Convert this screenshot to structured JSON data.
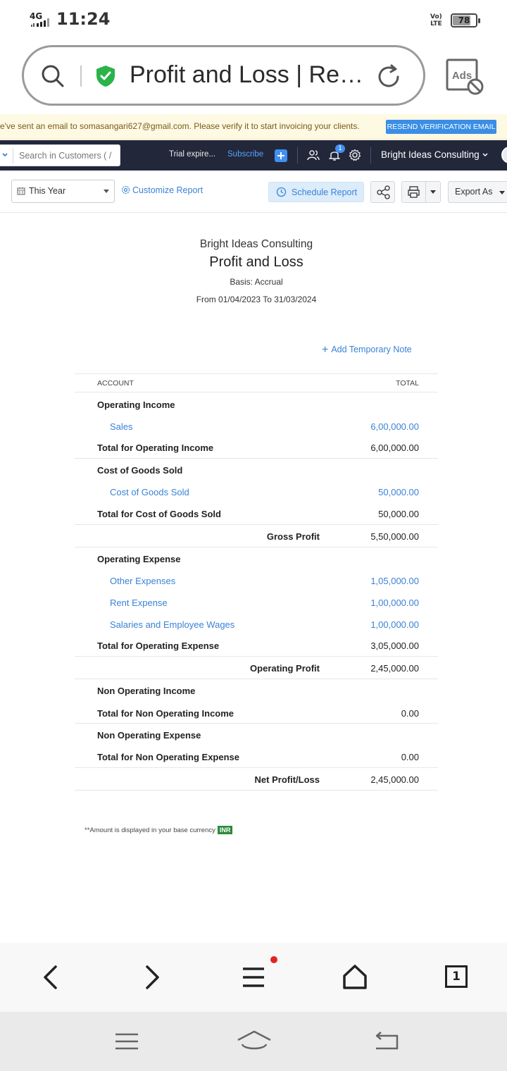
{
  "status_bar": {
    "network": "4G",
    "time": "11:24",
    "volte": "Vo) LTE",
    "battery_level": 78,
    "battery_text": "78"
  },
  "browser": {
    "tab_title": "Profit and Loss | Rep...",
    "ads_label": "Ads"
  },
  "banner": {
    "message": "e've sent an email to somasangari627@gmail.com. Please verify it to start invoicing your clients.",
    "button": "RESEND VERIFICATION EMAIL"
  },
  "app_bar": {
    "search_placeholder": "Search in Customers ( /",
    "trial_text": "Trial expire...",
    "subscribe": "Subscribe",
    "notification_count": "1",
    "org_name": "Bright Ideas Consulting"
  },
  "toolbar": {
    "period": "This Year",
    "customize": "Customize Report",
    "schedule": "Schedule Report",
    "export": "Export As"
  },
  "report": {
    "company": "Bright Ideas Consulting",
    "title": "Profit and Loss",
    "basis": "Basis: Accrual",
    "range": "From 01/04/2023 To 31/03/2024",
    "add_note": "Add Temporary Note",
    "col_account": "ACCOUNT",
    "col_total": "TOTAL",
    "rows": [
      {
        "label": "Operating Income",
        "amount": ""
      },
      {
        "label": "Sales",
        "amount": "6,00,000.00"
      },
      {
        "label": "Total for Operating Income",
        "amount": "6,00,000.00"
      },
      {
        "label": "Cost of Goods Sold",
        "amount": ""
      },
      {
        "label": "Cost of Goods Sold",
        "amount": "50,000.00"
      },
      {
        "label": "Total for Cost of Goods Sold",
        "amount": "50,000.00"
      },
      {
        "label": "Gross Profit",
        "amount": "5,50,000.00"
      },
      {
        "label": "Operating Expense",
        "amount": ""
      },
      {
        "label": "Other Expenses",
        "amount": "1,05,000.00"
      },
      {
        "label": "Rent Expense",
        "amount": "1,00,000.00"
      },
      {
        "label": "Salaries and Employee Wages",
        "amount": "1,00,000.00"
      },
      {
        "label": "Total for Operating Expense",
        "amount": "3,05,000.00"
      },
      {
        "label": "Operating Profit",
        "amount": "2,45,000.00"
      },
      {
        "label": "Non Operating Income",
        "amount": ""
      },
      {
        "label": "Total for Non Operating Income",
        "amount": "0.00"
      },
      {
        "label": "Non Operating Expense",
        "amount": ""
      },
      {
        "label": "Total for Non Operating Expense",
        "amount": "0.00"
      },
      {
        "label": "Net Profit/Loss",
        "amount": "2,45,000.00"
      }
    ],
    "footnote": "**Amount is displayed in your base currency",
    "currency": "INR"
  },
  "browser_nav": {
    "tabs_count": "1"
  },
  "colors": {
    "accent": "#3a82d6",
    "navbar": "#22283a",
    "banner_bg": "#fdf9e3",
    "currency_badge": "#2c8a3a"
  }
}
